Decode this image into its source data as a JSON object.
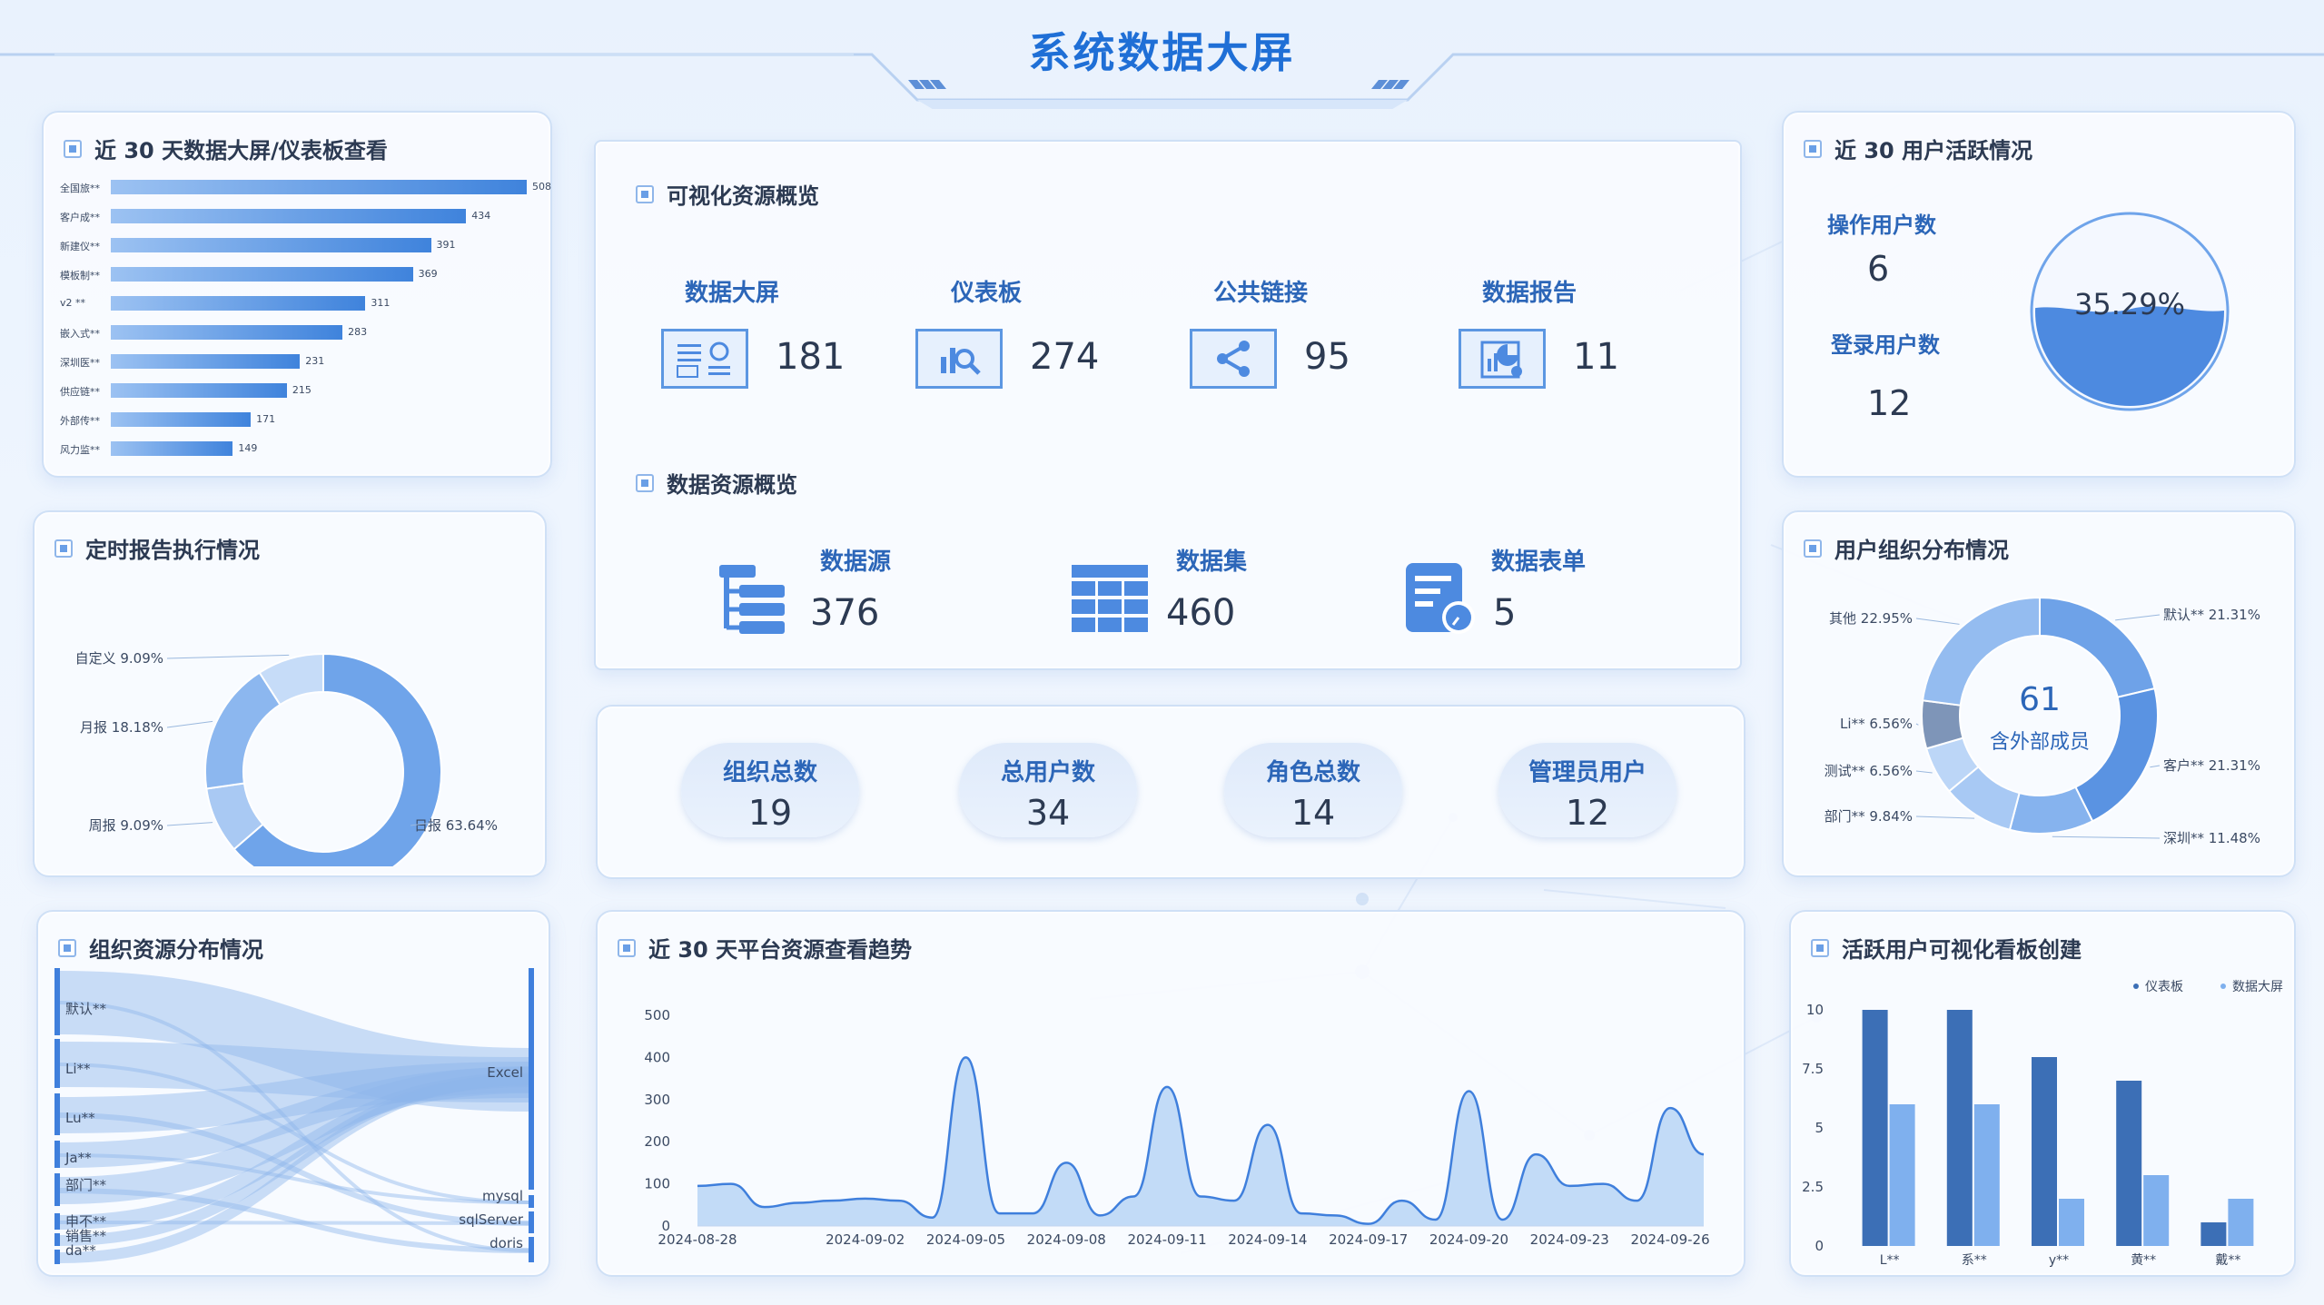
{
  "page": {
    "title": "系统数据大屏"
  },
  "panels": {
    "views30": "近 30 天数据大屏/仪表板查看",
    "report": "定时报告执行情况",
    "orgres": "组织资源分布情况",
    "visual": "可视化资源概览",
    "datares": "数据资源概览",
    "trend": "近 30 天平台资源查看趋势",
    "active": "近 30 用户活跃情况",
    "orgdist": "用户组织分布情况",
    "create": "活跃用户可视化看板创建"
  },
  "views_list": [
    {
      "label": "全国旅**",
      "value": 508
    },
    {
      "label": "客户成**",
      "value": 434
    },
    {
      "label": "新建仪**",
      "value": 391
    },
    {
      "label": "模板制**",
      "value": 369
    },
    {
      "label": "v2 **",
      "value": 311
    },
    {
      "label": "嵌入式**",
      "value": 283
    },
    {
      "label": "深圳医**",
      "value": 231
    },
    {
      "label": "供应链**",
      "value": 215
    },
    {
      "label": "外部传**",
      "value": 171
    },
    {
      "label": "风力监**",
      "value": 149
    }
  ],
  "visual_stats": [
    {
      "label": "数据大屏",
      "value": "181",
      "icon": "screen-icon"
    },
    {
      "label": "仪表板",
      "value": "274",
      "icon": "dashboard-icon"
    },
    {
      "label": "公共链接",
      "value": "95",
      "icon": "share-icon"
    },
    {
      "label": "数据报告",
      "value": "11",
      "icon": "report-icon"
    }
  ],
  "data_stats": [
    {
      "label": "数据源",
      "value": "376",
      "icon": "datasource-icon"
    },
    {
      "label": "数据集",
      "value": "460",
      "icon": "dataset-icon"
    },
    {
      "label": "数据表单",
      "value": "5",
      "icon": "form-icon"
    }
  ],
  "summary": [
    {
      "label": "组织总数",
      "value": "19"
    },
    {
      "label": "总用户数",
      "value": "34"
    },
    {
      "label": "角色总数",
      "value": "14"
    },
    {
      "label": "管理员用户",
      "value": "12"
    }
  ],
  "active_users": {
    "op_label": "操作用户数",
    "op_value": "6",
    "login_label": "登录用户数",
    "login_value": "12",
    "ratio": "35.29%",
    "ratio_fraction": 0.3529
  },
  "report_pie": [
    {
      "label": "日报 63.64%",
      "value": 63.64,
      "color": "#6fa4ea"
    },
    {
      "label": "周报 9.09%",
      "value": 9.09,
      "color": "#a9c9f3"
    },
    {
      "label": "月报 18.18%",
      "value": 18.18,
      "color": "#8cb7ef"
    },
    {
      "label": "自定义 9.09%",
      "value": 9.09,
      "color": "#c6dcf8"
    }
  ],
  "org_pie": {
    "center_value": "61",
    "center_label": "含外部成员",
    "slices": [
      {
        "label": "默认** 21.31%",
        "value": 21.31,
        "color": "#6ea2e8"
      },
      {
        "label": "客户** 21.31%",
        "value": 21.31,
        "color": "#5a93e2"
      },
      {
        "label": "深圳** 11.48%",
        "value": 11.48,
        "color": "#86b3ee"
      },
      {
        "label": "部门** 9.84%",
        "value": 9.84,
        "color": "#a8c9f4"
      },
      {
        "label": "测试** 6.56%",
        "value": 6.56,
        "color": "#bcd6f7"
      },
      {
        "label": "Li** 6.56%",
        "value": 6.56,
        "color": "#7e95b8"
      },
      {
        "label": "其他 22.95%",
        "value": 22.95,
        "color": "#94bcf0"
      }
    ]
  },
  "sankey": {
    "left": [
      "默认**",
      "Li**",
      "Lu**",
      "Ja**",
      "部门**",
      "申不**",
      "销售**",
      "da**"
    ],
    "right": [
      "Excel",
      "mysql",
      "sqlServer",
      "doris"
    ]
  },
  "chart_data": [
    {
      "type": "area",
      "title": "近 30 天平台资源查看趋势",
      "x": [
        "2024-08-28",
        "2024-08-29",
        "2024-08-30",
        "2024-08-31",
        "2024-09-01",
        "2024-09-02",
        "2024-09-03",
        "2024-09-04",
        "2024-09-05",
        "2024-09-06",
        "2024-09-07",
        "2024-09-08",
        "2024-09-09",
        "2024-09-10",
        "2024-09-11",
        "2024-09-12",
        "2024-09-13",
        "2024-09-14",
        "2024-09-15",
        "2024-09-16",
        "2024-09-17",
        "2024-09-18",
        "2024-09-19",
        "2024-09-20",
        "2024-09-21",
        "2024-09-22",
        "2024-09-23",
        "2024-09-24",
        "2024-09-25",
        "2024-09-26",
        "2024-09-27"
      ],
      "xticks": [
        "2024-08-28",
        "2024-09-02",
        "2024-09-05",
        "2024-09-08",
        "2024-09-11",
        "2024-09-14",
        "2024-09-17",
        "2024-09-20",
        "2024-09-23",
        "2024-09-26"
      ],
      "values": [
        95,
        100,
        45,
        55,
        60,
        65,
        60,
        20,
        400,
        30,
        30,
        150,
        25,
        70,
        330,
        70,
        60,
        240,
        30,
        25,
        5,
        60,
        15,
        320,
        15,
        170,
        95,
        100,
        60,
        280,
        170
      ],
      "ylim": [
        0,
        500
      ],
      "yticks": [
        0,
        100,
        200,
        300,
        400,
        500
      ]
    },
    {
      "type": "bar",
      "title": "活跃用户可视化看板创建",
      "categories": [
        "L**",
        "系**",
        "y**",
        "黄**",
        "戴**"
      ],
      "series": [
        {
          "name": "仪表板",
          "values": [
            10,
            10,
            8,
            7,
            1
          ],
          "color": "#3c6fb6"
        },
        {
          "name": "数据大屏",
          "values": [
            6,
            6,
            2,
            3,
            2
          ],
          "color": "#7fb0ee"
        }
      ],
      "ylim": [
        0,
        10
      ],
      "yticks": [
        "0",
        "2.5",
        "5",
        "7.5",
        "10"
      ]
    }
  ]
}
